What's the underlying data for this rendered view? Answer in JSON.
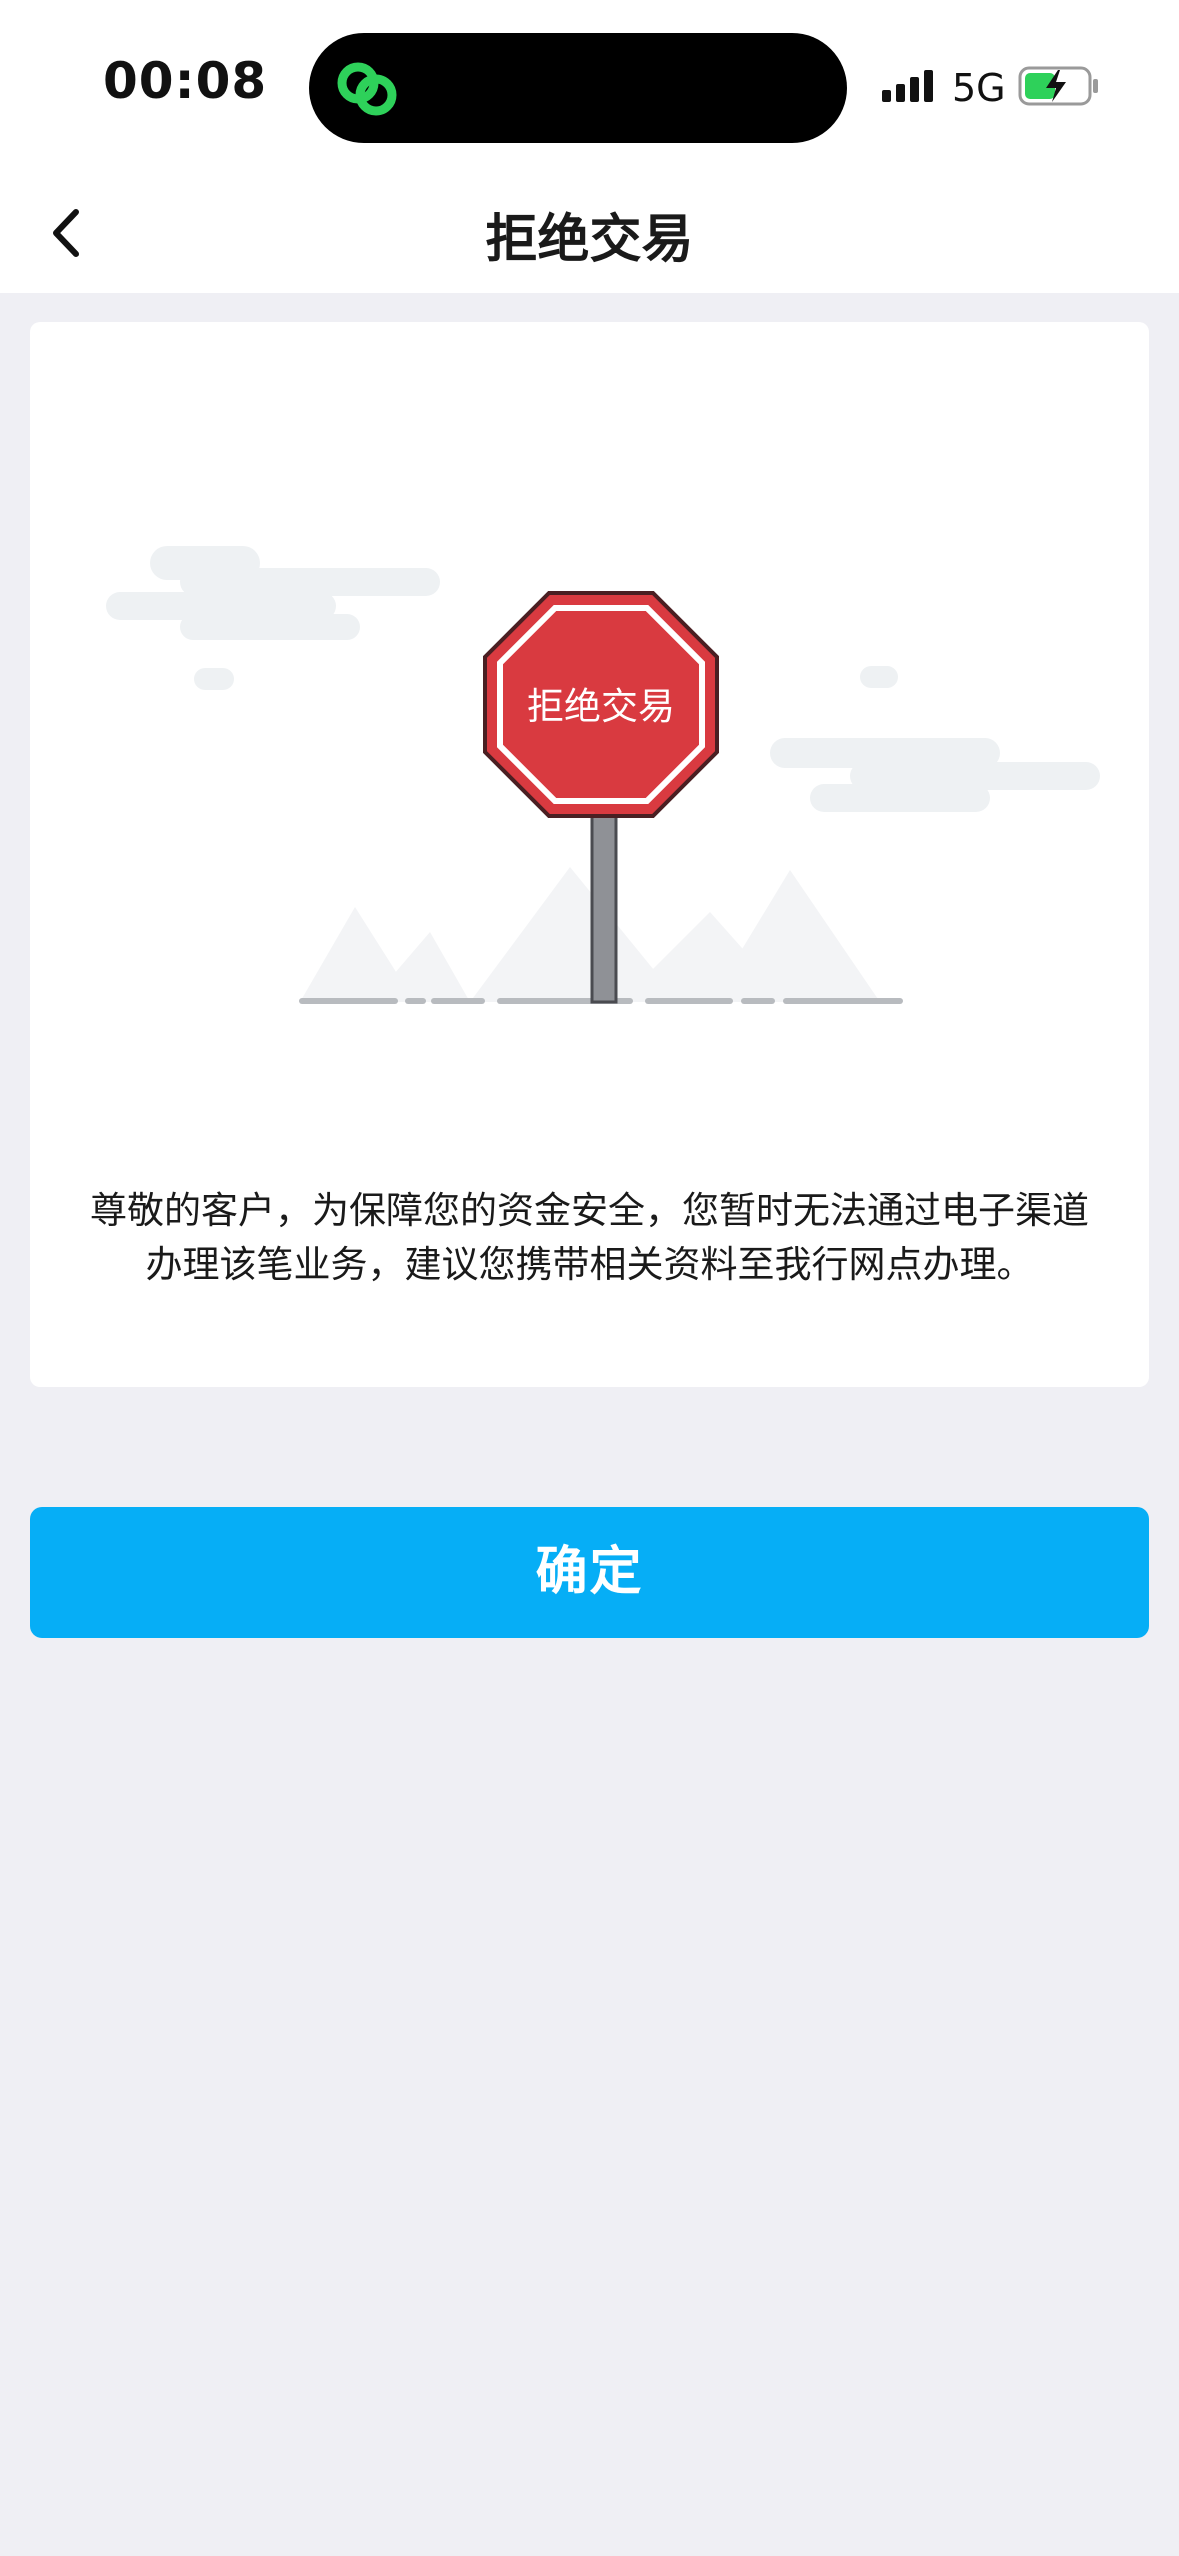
{
  "status_bar": {
    "time": "00:08",
    "network": "5G",
    "accent_color": "#2ed15a"
  },
  "nav": {
    "title": "拒绝交易"
  },
  "card": {
    "sign_text": "拒绝交易",
    "message_line1": "尊敬的客户，为保障您的资金安全，您暂时无法通过电子渠道",
    "message_line2": "办理该笔业务，建议您携带相关资料至我行网点办理。"
  },
  "actions": {
    "confirm_label": "确定"
  },
  "colors": {
    "primary": "#06aef6",
    "sign_red": "#d93a40",
    "background": "#efeff4"
  }
}
